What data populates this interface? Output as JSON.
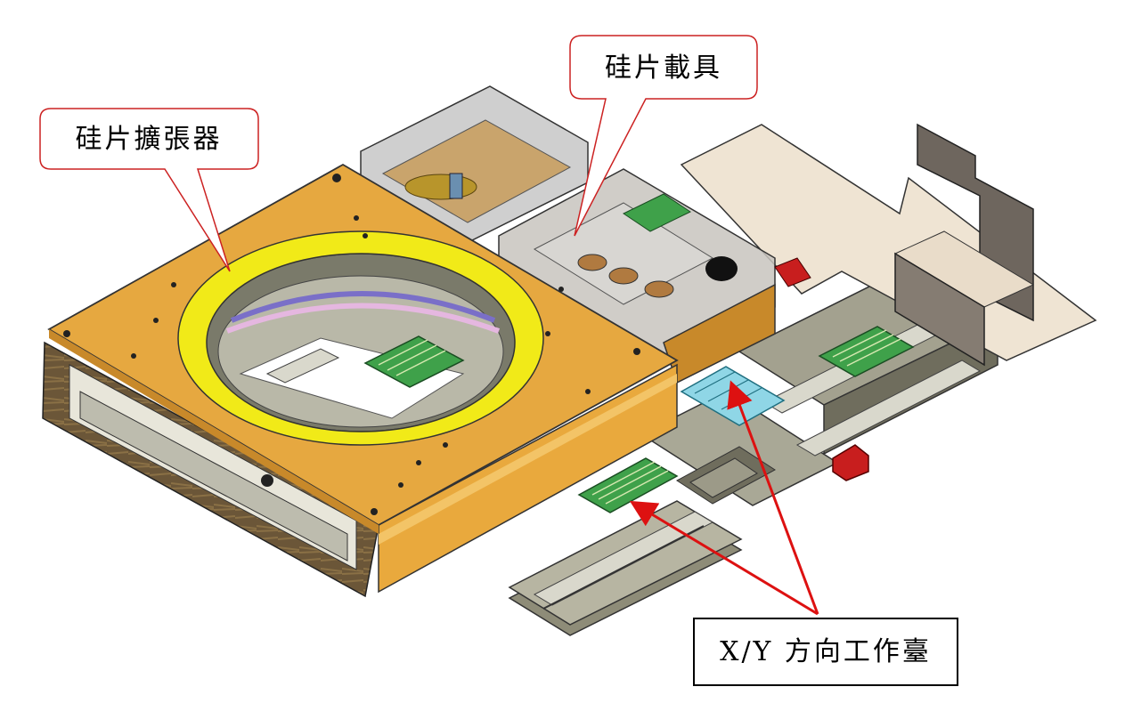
{
  "labels": {
    "expander": "硅片擴張器",
    "carrier": "硅片載具",
    "xy_table": "X/Y 方向工作臺"
  },
  "colors": {
    "plate": "#e6a840",
    "plate_dark": "#c8892a",
    "ring": "#f1ea18",
    "steel": "#8c8c7e",
    "steel_light": "#b9b8a8",
    "pcb": "#3fa14a",
    "frame_side": "#6e5a3a",
    "callout_border": "#cc2222",
    "arrow": "#dd1111"
  }
}
